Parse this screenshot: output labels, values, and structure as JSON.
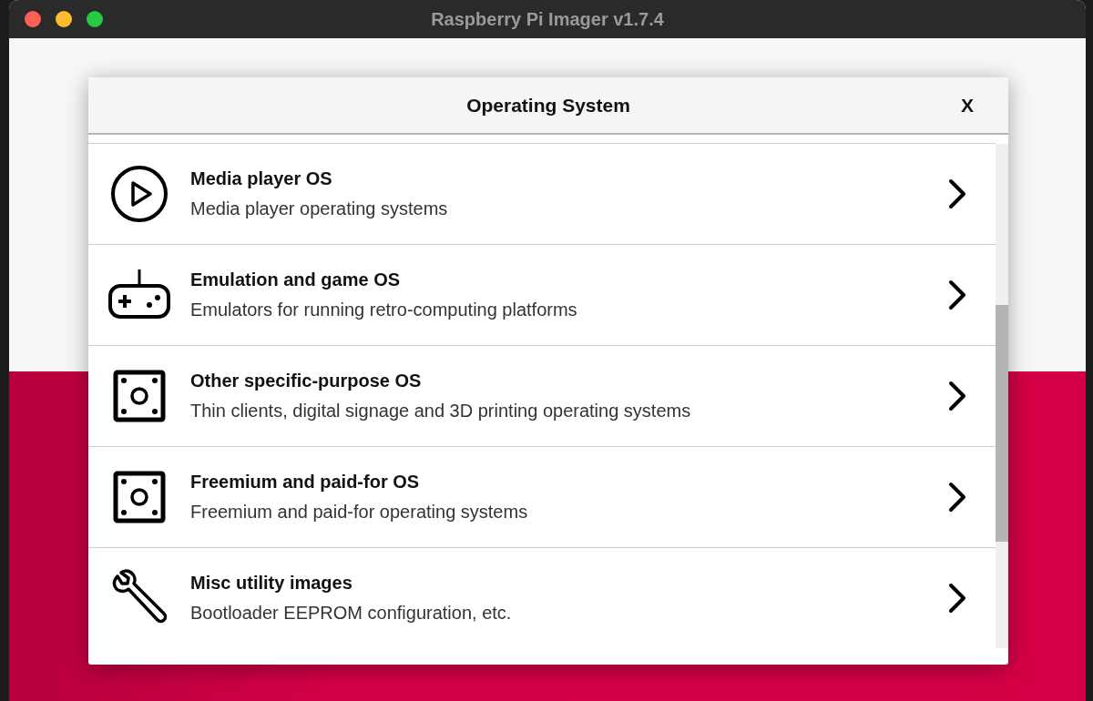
{
  "window": {
    "title": "Raspberry Pi Imager v1.7.4"
  },
  "dialog": {
    "title": "Operating System",
    "close": "X",
    "items": [
      {
        "kind": "play",
        "title": "Media player OS",
        "description": "Media player operating systems"
      },
      {
        "kind": "gamepad",
        "title": "Emulation and game OS",
        "description": "Emulators for running retro-computing platforms"
      },
      {
        "kind": "board",
        "title": "Other specific-purpose OS",
        "description": "Thin clients, digital signage and 3D printing operating systems"
      },
      {
        "kind": "board",
        "title": "Freemium and paid-for OS",
        "description": "Freemium and paid-for operating systems"
      },
      {
        "kind": "wrench",
        "title": "Misc utility images",
        "description": "Bootloader EEPROM configuration, etc."
      }
    ]
  }
}
